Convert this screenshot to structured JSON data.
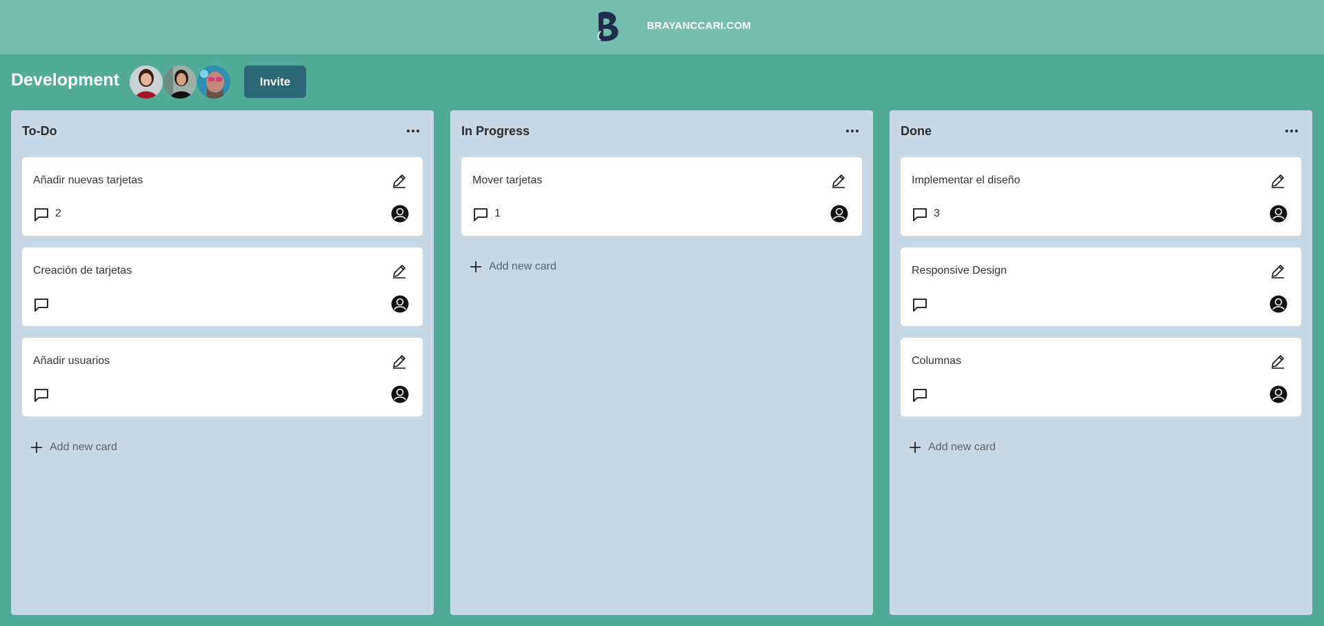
{
  "header": {
    "brand": "BRAYANCCARI.COM",
    "logo_icon": "brand-b-logo",
    "background": "#75bdaf"
  },
  "board": {
    "title": "Development",
    "invite_label": "Invite",
    "members": [
      {
        "avatar": "member-avatar-1"
      },
      {
        "avatar": "member-avatar-2"
      },
      {
        "avatar": "member-avatar-3"
      }
    ]
  },
  "colors": {
    "page_bg": "#52ab98",
    "column_bg": "#c8d8e4",
    "card_bg": "#ffffff",
    "invite_bg": "#2b6777"
  },
  "columns": [
    {
      "title": "To-Do",
      "menu_icon": "more-horizontal-icon",
      "add_label": "Add new card",
      "cards": [
        {
          "title": "Añadir nuevas tarjetas",
          "comments": "2"
        },
        {
          "title": "Creación de tarjetas",
          "comments": ""
        },
        {
          "title": "Añadir usuarios",
          "comments": ""
        }
      ]
    },
    {
      "title": "In Progress",
      "menu_icon": "more-horizontal-icon",
      "add_label": "Add new card",
      "cards": [
        {
          "title": "Mover tarjetas",
          "comments": "1"
        }
      ]
    },
    {
      "title": "Done",
      "menu_icon": "more-horizontal-icon",
      "add_label": "Add new card",
      "cards": [
        {
          "title": "Implementar el diseño",
          "comments": "3"
        },
        {
          "title": "Responsive Design",
          "comments": ""
        },
        {
          "title": "Columnas",
          "comments": ""
        }
      ]
    }
  ]
}
